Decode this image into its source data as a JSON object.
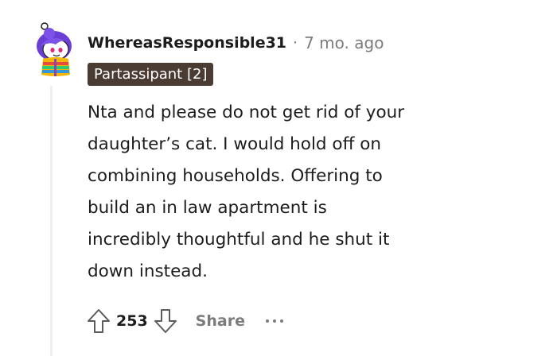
{
  "comment": {
    "username": "WhereasResponsible31",
    "separator": "·",
    "timestamp": "7 mo. ago",
    "flair": "Partassipant [2]",
    "avatar_icon": "snoo-avatar-icon",
    "body_lines": [
      "Nta and please do not get rid of your",
      "daughter’s cat. I would hold off on",
      "combining households. Offering to",
      "build an in law apartment is",
      "incredibly thoughtful and he shut it",
      "down instead."
    ]
  },
  "actions": {
    "upvote_icon": "upvote-arrow-icon",
    "score": "253",
    "downvote_icon": "downvote-arrow-icon",
    "share_label": "Share",
    "more_icon": "more-options-icon"
  },
  "colors": {
    "flair_bg": "#4a3c33",
    "muted_text": "#7c7c7c",
    "thread_line": "#edeff1",
    "text": "#1c1c1c"
  }
}
